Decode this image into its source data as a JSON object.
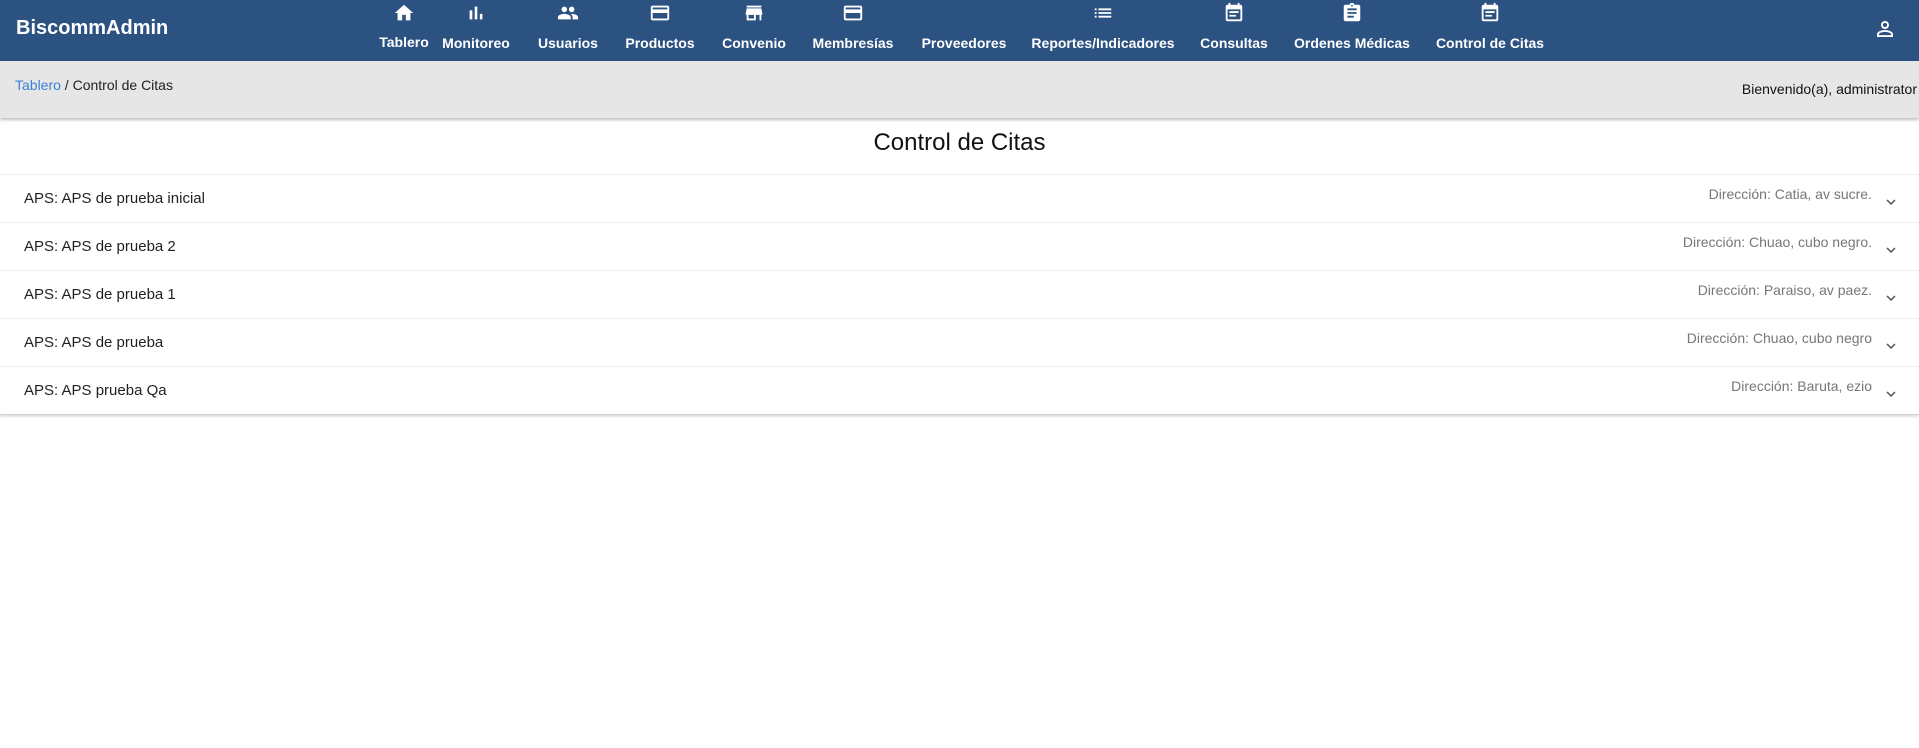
{
  "brand": "BiscommAdmin",
  "nav": [
    {
      "label": "Tablero",
      "icon": "home-icon"
    },
    {
      "label": "Monitoreo",
      "icon": "bar-chart-icon"
    },
    {
      "label": "Usuarios",
      "icon": "people-icon"
    },
    {
      "label": "Productos",
      "icon": "credit-card-icon"
    },
    {
      "label": "Convenio",
      "icon": "store-icon"
    },
    {
      "label": "Membresías",
      "icon": "credit-card-icon"
    },
    {
      "label": "Proveedores",
      "icon": ""
    },
    {
      "label": "Reportes/Indicadores",
      "icon": "list-icon"
    },
    {
      "label": "Consultas",
      "icon": "calendar-icon"
    },
    {
      "label": "Ordenes Médicas",
      "icon": "clipboard-icon"
    },
    {
      "label": "Control de Citas",
      "icon": "calendar-icon"
    }
  ],
  "user_icon": "person-icon",
  "breadcrumb": {
    "link": "Tablero",
    "separator": " / ",
    "current": "Control de Citas"
  },
  "welcome": "Bienvenido(a), administrator",
  "page_title": "Control de Citas",
  "aps_list": [
    {
      "title": "APS: APS de prueba inicial",
      "address": "Dirección: Catia, av sucre."
    },
    {
      "title": "APS: APS de prueba 2",
      "address": "Dirección: Chuao, cubo negro."
    },
    {
      "title": "APS: APS de prueba 1",
      "address": "Dirección: Paraiso, av paez."
    },
    {
      "title": "APS: APS de prueba",
      "address": "Dirección: Chuao, cubo negro"
    },
    {
      "title": "APS: APS prueba Qa",
      "address": "Dirección: Baruta, ezio"
    }
  ],
  "colors": {
    "topbar": "#2c5282",
    "subbar": "#e6e6e6",
    "link": "#3b82d6"
  }
}
